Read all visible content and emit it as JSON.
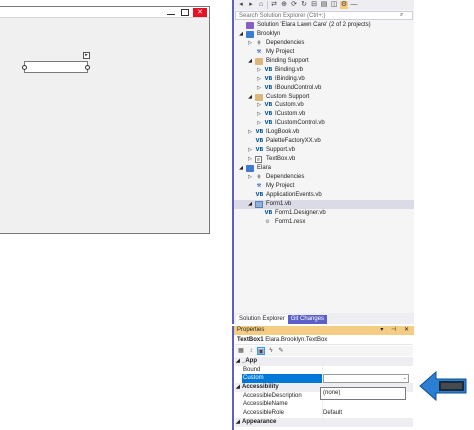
{
  "form_designer": {
    "close_glyph": "✕",
    "restore_glyph": "▭",
    "smart_tag_glyph": "▸"
  },
  "solution_explorer": {
    "search_placeholder": "Search Solution Explorer (Ctrl+;)",
    "toolbar_icons": [
      "back-icon",
      "forward-icon",
      "home-icon",
      "switch-views-icon",
      "pending-changes-icon",
      "sync-icon",
      "refresh-icon",
      "collapse-all-icon",
      "show-all-files-icon",
      "preview-icon",
      "properties-icon"
    ],
    "tree": [
      {
        "label": "Solution 'Elara Lawn Care' (2 of 2 projects)",
        "icon": "solution",
        "depth": 0,
        "arrow": ""
      },
      {
        "label": "Brooklyn",
        "icon": "proj",
        "depth": 0,
        "arrow": "◢"
      },
      {
        "label": "Dependencies",
        "icon": "dep",
        "depth": 1,
        "arrow": "▷"
      },
      {
        "label": "My Project",
        "icon": "myproj",
        "depth": 1,
        "arrow": ""
      },
      {
        "label": "Binding Support",
        "icon": "folder",
        "depth": 1,
        "arrow": "◢"
      },
      {
        "label": "Binding.vb",
        "icon": "vb",
        "depth": 2,
        "arrow": "▷"
      },
      {
        "label": "IBinding.vb",
        "icon": "vb",
        "depth": 2,
        "arrow": "▷"
      },
      {
        "label": "IBoundControl.vb",
        "icon": "vb",
        "depth": 2,
        "arrow": "▷"
      },
      {
        "label": "Custom Support",
        "icon": "folder",
        "depth": 1,
        "arrow": "◢"
      },
      {
        "label": "Custom.vb",
        "icon": "vb",
        "depth": 2,
        "arrow": "▷"
      },
      {
        "label": "ICustom.vb",
        "icon": "vb",
        "depth": 2,
        "arrow": "▷"
      },
      {
        "label": "ICustomControl.vb",
        "icon": "vb",
        "depth": 2,
        "arrow": "▷"
      },
      {
        "label": "ILogBook.vb",
        "icon": "vb",
        "depth": 1,
        "arrow": "▷"
      },
      {
        "label": "PaletteFactoryXX.vb",
        "icon": "vb",
        "depth": 1,
        "arrow": ""
      },
      {
        "label": "Support.vb",
        "icon": "vb",
        "depth": 1,
        "arrow": "▷"
      },
      {
        "label": "TextBox.vb",
        "icon": "textfile",
        "depth": 1,
        "arrow": "▷"
      },
      {
        "label": "Elara",
        "icon": "proj",
        "depth": 0,
        "arrow": "◢"
      },
      {
        "label": "Dependencies",
        "icon": "dep",
        "depth": 1,
        "arrow": "▷"
      },
      {
        "label": "My Project",
        "icon": "myproj",
        "depth": 1,
        "arrow": ""
      },
      {
        "label": "ApplicationEvents.vb",
        "icon": "vb",
        "depth": 1,
        "arrow": ""
      },
      {
        "label": "Form1.vb",
        "icon": "formi",
        "depth": 1,
        "arrow": "◢",
        "selected": true
      },
      {
        "label": "Form1.Designer.vb",
        "icon": "vb",
        "depth": 2,
        "arrow": ""
      },
      {
        "label": "Form1.resx",
        "icon": "resx",
        "depth": 2,
        "arrow": ""
      }
    ],
    "tabs": [
      {
        "label": "Solution Explorer",
        "active": true
      },
      {
        "label": "Git Changes",
        "active": false
      }
    ]
  },
  "properties": {
    "title": "Properties",
    "header_buttons": "▾ ⊣ ✕",
    "object_name": "TextBox1",
    "object_type": "Elara.Brooklyn.TextBox",
    "rows": [
      {
        "kind": "cat",
        "label": "_App",
        "expander": "◢"
      },
      {
        "kind": "prop",
        "label": "Bound",
        "value": ""
      },
      {
        "kind": "sel",
        "label": "Custom",
        "value": ""
      },
      {
        "kind": "cat",
        "label": "Accessibility",
        "expander": "◢"
      },
      {
        "kind": "prop",
        "label": "AccessibleDescription",
        "value": ""
      },
      {
        "kind": "prop",
        "label": "AccessibleName",
        "value": ""
      },
      {
        "kind": "prop",
        "label": "AccessibleRole",
        "value": "Default"
      },
      {
        "kind": "cat",
        "label": "Appearance",
        "expander": "◢"
      }
    ],
    "dropdown_option": "(none)"
  },
  "colors": {
    "accent_border": "#5b5fc7",
    "header_gold": "#f5cc84",
    "selection_blue": "#0078d7",
    "annotation_blue": "#2b7fd3"
  }
}
